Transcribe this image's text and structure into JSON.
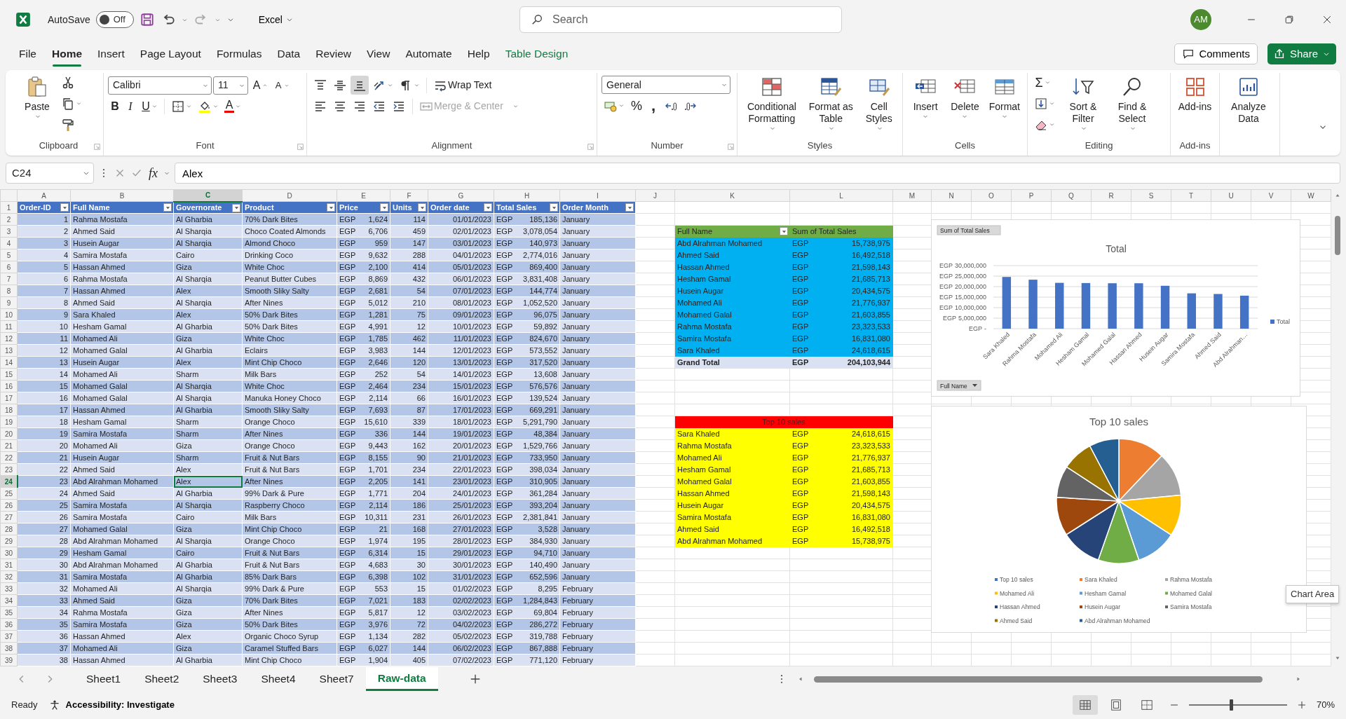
{
  "window": {
    "autosave": {
      "label": "AutoSave",
      "on": false,
      "state_text": "Off"
    },
    "app_menu": "Excel",
    "search": {
      "placeholder": "Search"
    },
    "avatar": "AM"
  },
  "menu_tabs": [
    {
      "label": "File",
      "selected": false,
      "kind": "plain"
    },
    {
      "label": "Home",
      "selected": true,
      "kind": "plain"
    },
    {
      "label": "Insert",
      "selected": false,
      "kind": "plain"
    },
    {
      "label": "Page Layout",
      "selected": false,
      "kind": "plain"
    },
    {
      "label": "Formulas",
      "selected": false,
      "kind": "plain"
    },
    {
      "label": "Data",
      "selected": false,
      "kind": "plain"
    },
    {
      "label": "Review",
      "selected": false,
      "kind": "plain"
    },
    {
      "label": "View",
      "selected": false,
      "kind": "plain"
    },
    {
      "label": "Automate",
      "selected": false,
      "kind": "plain"
    },
    {
      "label": "Help",
      "selected": false,
      "kind": "plain"
    },
    {
      "label": "Table Design",
      "selected": false,
      "kind": "contextual"
    }
  ],
  "comments": "Comments",
  "share": "Share",
  "ribbon": {
    "groups": [
      {
        "kind": "clipboard",
        "label": "Clipboard",
        "launcher": true,
        "paste": "Paste"
      },
      {
        "kind": "font",
        "label": "Font",
        "launcher": true,
        "font_name": "Calibri",
        "font_size": "11",
        "grow": "A",
        "shrink": "A",
        "bold": "B",
        "italic": "I",
        "underline": "U",
        "font_color": "A"
      },
      {
        "kind": "alignment",
        "label": "Alignment",
        "launcher": true,
        "vertical": [
          {
            "selected": false
          },
          {
            "selected": false
          },
          {
            "selected": true
          }
        ],
        "wrap_text": "Wrap Text",
        "merge": {
          "label": "Merge & Center",
          "disabled": true
        }
      },
      {
        "kind": "number",
        "label": "Number",
        "launcher": true,
        "format": "General",
        "percent": "%",
        "comma": ","
      },
      {
        "kind": "styles",
        "label": "Styles",
        "buttons": [
          "Conditional Formatting",
          "Format as Table",
          "Cell Styles"
        ]
      },
      {
        "kind": "cells",
        "label": "Cells",
        "buttons": [
          "Insert",
          "Delete",
          "Format"
        ]
      },
      {
        "kind": "editing",
        "label": "Editing",
        "sum": "Σ",
        "buttons": [
          "Sort & Filter",
          "Find & Select"
        ]
      },
      {
        "kind": "addins",
        "label": "Add-ins",
        "buttons": [
          "Add-ins"
        ]
      },
      {
        "kind": "analyze",
        "buttons": [
          "Analyze Data"
        ]
      }
    ]
  },
  "formula_bar": {
    "name_box": "C24",
    "fx": "fx",
    "value": "Alex"
  },
  "sheet": {
    "columns": [
      {
        "label": "A",
        "selected": false
      },
      {
        "label": "B",
        "selected": false
      },
      {
        "label": "C",
        "selected": true
      },
      {
        "label": "D",
        "selected": false
      },
      {
        "label": "E",
        "selected": false
      },
      {
        "label": "F",
        "selected": false
      },
      {
        "label": "G",
        "selected": false
      },
      {
        "label": "H",
        "selected": false
      },
      {
        "label": "I",
        "selected": false
      },
      {
        "label": "J",
        "selected": false
      },
      {
        "label": "K",
        "selected": false
      },
      {
        "label": "L",
        "selected": false
      },
      {
        "label": "M",
        "selected": false
      },
      {
        "label": "N",
        "selected": false
      },
      {
        "label": "O",
        "selected": false
      },
      {
        "label": "P",
        "selected": false
      },
      {
        "label": "Q",
        "selected": false
      },
      {
        "label": "R",
        "selected": false
      },
      {
        "label": "S",
        "selected": false
      },
      {
        "label": "T",
        "selected": false
      },
      {
        "label": "U",
        "selected": false
      },
      {
        "label": "V",
        "selected": false
      },
      {
        "label": "W",
        "selected": false
      }
    ],
    "table": {
      "header_row_number": "1",
      "headers": [
        "Order-ID",
        "Full Name",
        "Governorate",
        "Product",
        "Price",
        "Units",
        "Order date",
        "Total Sales",
        "Order Month"
      ],
      "rows": [
        {
          "n": "2",
          "selected": false,
          "cells": [
            "1",
            "Rahma Mostafa",
            "Al Gharbia",
            "70% Dark Bites",
            "EGP",
            "1,624",
            "114",
            "01/01/2023",
            "EGP",
            "185,136",
            "January"
          ]
        },
        {
          "n": "3",
          "selected": false,
          "cells": [
            "2",
            "Ahmed Said",
            "Al Sharqia",
            "Choco Coated Almonds",
            "EGP",
            "6,706",
            "459",
            "02/01/2023",
            "EGP",
            "3,078,054",
            "January"
          ]
        },
        {
          "n": "4",
          "selected": false,
          "cells": [
            "3",
            "Husein Augar",
            "Al Sharqia",
            "Almond Choco",
            "EGP",
            "959",
            "147",
            "03/01/2023",
            "EGP",
            "140,973",
            "January"
          ]
        },
        {
          "n": "5",
          "selected": false,
          "cells": [
            "4",
            "Samira Mostafa",
            "Cairo",
            "Drinking Coco",
            "EGP",
            "9,632",
            "288",
            "04/01/2023",
            "EGP",
            "2,774,016",
            "January"
          ]
        },
        {
          "n": "6",
          "selected": false,
          "cells": [
            "5",
            "Hassan Ahmed",
            "Giza",
            "White Choc",
            "EGP",
            "2,100",
            "414",
            "05/01/2023",
            "EGP",
            "869,400",
            "January"
          ]
        },
        {
          "n": "7",
          "selected": false,
          "cells": [
            "6",
            "Rahma Mostafa",
            "Al Sharqia",
            "Peanut Butter Cubes",
            "EGP",
            "8,869",
            "432",
            "06/01/2023",
            "EGP",
            "3,831,408",
            "January"
          ]
        },
        {
          "n": "8",
          "selected": false,
          "cells": [
            "7",
            "Hassan Ahmed",
            "Alex",
            "Smooth Sliky Salty",
            "EGP",
            "2,681",
            "54",
            "07/01/2023",
            "EGP",
            "144,774",
            "January"
          ]
        },
        {
          "n": "9",
          "selected": false,
          "cells": [
            "8",
            "Ahmed Said",
            "Al Sharqia",
            "After Nines",
            "EGP",
            "5,012",
            "210",
            "08/01/2023",
            "EGP",
            "1,052,520",
            "January"
          ]
        },
        {
          "n": "10",
          "selected": false,
          "cells": [
            "9",
            "Sara Khaled",
            "Alex",
            "50% Dark Bites",
            "EGP",
            "1,281",
            "75",
            "09/01/2023",
            "EGP",
            "96,075",
            "January"
          ]
        },
        {
          "n": "11",
          "selected": false,
          "cells": [
            "10",
            "Hesham Gamal",
            "Al Gharbia",
            "50% Dark Bites",
            "EGP",
            "4,991",
            "12",
            "10/01/2023",
            "EGP",
            "59,892",
            "January"
          ]
        },
        {
          "n": "12",
          "selected": false,
          "cells": [
            "11",
            "Mohamed Ali",
            "Giza",
            "White Choc",
            "EGP",
            "1,785",
            "462",
            "11/01/2023",
            "EGP",
            "824,670",
            "January"
          ]
        },
        {
          "n": "13",
          "selected": false,
          "cells": [
            "12",
            "Mohamed Galal",
            "Al Gharbia",
            "Eclairs",
            "EGP",
            "3,983",
            "144",
            "12/01/2023",
            "EGP",
            "573,552",
            "January"
          ]
        },
        {
          "n": "14",
          "selected": false,
          "cells": [
            "13",
            "Husein Augar",
            "Alex",
            "Mint Chip Choco",
            "EGP",
            "2,646",
            "120",
            "13/01/2023",
            "EGP",
            "317,520",
            "January"
          ]
        },
        {
          "n": "15",
          "selected": false,
          "cells": [
            "14",
            "Mohamed Ali",
            "Sharm",
            "Milk Bars",
            "EGP",
            "252",
            "54",
            "14/01/2023",
            "EGP",
            "13,608",
            "January"
          ]
        },
        {
          "n": "16",
          "selected": false,
          "cells": [
            "15",
            "Mohamed Galal",
            "Al Sharqia",
            "White Choc",
            "EGP",
            "2,464",
            "234",
            "15/01/2023",
            "EGP",
            "576,576",
            "January"
          ]
        },
        {
          "n": "17",
          "selected": false,
          "cells": [
            "16",
            "Mohamed Galal",
            "Al Sharqia",
            "Manuka Honey Choco",
            "EGP",
            "2,114",
            "66",
            "16/01/2023",
            "EGP",
            "139,524",
            "January"
          ]
        },
        {
          "n": "18",
          "selected": false,
          "cells": [
            "17",
            "Hassan Ahmed",
            "Al Gharbia",
            "Smooth Sliky Salty",
            "EGP",
            "7,693",
            "87",
            "17/01/2023",
            "EGP",
            "669,291",
            "January"
          ]
        },
        {
          "n": "19",
          "selected": false,
          "cells": [
            "18",
            "Hesham Gamal",
            "Sharm",
            "Orange Choco",
            "EGP",
            "15,610",
            "339",
            "18/01/2023",
            "EGP",
            "5,291,790",
            "January"
          ]
        },
        {
          "n": "20",
          "selected": false,
          "cells": [
            "19",
            "Samira Mostafa",
            "Sharm",
            "After Nines",
            "EGP",
            "336",
            "144",
            "19/01/2023",
            "EGP",
            "48,384",
            "January"
          ]
        },
        {
          "n": "21",
          "selected": false,
          "cells": [
            "20",
            "Mohamed Ali",
            "Giza",
            "Orange Choco",
            "EGP",
            "9,443",
            "162",
            "20/01/2023",
            "EGP",
            "1,529,766",
            "January"
          ]
        },
        {
          "n": "22",
          "selected": false,
          "cells": [
            "21",
            "Husein Augar",
            "Sharm",
            "Fruit & Nut Bars",
            "EGP",
            "8,155",
            "90",
            "21/01/2023",
            "EGP",
            "733,950",
            "January"
          ]
        },
        {
          "n": "23",
          "selected": false,
          "cells": [
            "22",
            "Ahmed Said",
            "Alex",
            "Fruit & Nut Bars",
            "EGP",
            "1,701",
            "234",
            "22/01/2023",
            "EGP",
            "398,034",
            "January"
          ]
        },
        {
          "n": "24",
          "selected": true,
          "cells": [
            "23",
            "Abd Alrahman Mohamed",
            "Alex",
            "After Nines",
            "EGP",
            "2,205",
            "141",
            "23/01/2023",
            "EGP",
            "310,905",
            "January"
          ]
        },
        {
          "n": "25",
          "selected": false,
          "cells": [
            "24",
            "Ahmed Said",
            "Al Gharbia",
            "99% Dark & Pure",
            "EGP",
            "1,771",
            "204",
            "24/01/2023",
            "EGP",
            "361,284",
            "January"
          ]
        },
        {
          "n": "26",
          "selected": false,
          "cells": [
            "25",
            "Samira Mostafa",
            "Al Sharqia",
            "Raspberry Choco",
            "EGP",
            "2,114",
            "186",
            "25/01/2023",
            "EGP",
            "393,204",
            "January"
          ]
        },
        {
          "n": "27",
          "selected": false,
          "cells": [
            "26",
            "Samira Mostafa",
            "Cairo",
            "Milk Bars",
            "EGP",
            "10,311",
            "231",
            "26/01/2023",
            "EGP",
            "2,381,841",
            "January"
          ]
        },
        {
          "n": "28",
          "selected": false,
          "cells": [
            "27",
            "Mohamed Galal",
            "Giza",
            "Mint Chip Choco",
            "EGP",
            "21",
            "168",
            "27/01/2023",
            "EGP",
            "3,528",
            "January"
          ]
        },
        {
          "n": "29",
          "selected": false,
          "cells": [
            "28",
            "Abd Alrahman Mohamed",
            "Al Sharqia",
            "Orange Choco",
            "EGP",
            "1,974",
            "195",
            "28/01/2023",
            "EGP",
            "384,930",
            "January"
          ]
        },
        {
          "n": "30",
          "selected": false,
          "cells": [
            "29",
            "Hesham Gamal",
            "Cairo",
            "Fruit & Nut Bars",
            "EGP",
            "6,314",
            "15",
            "29/01/2023",
            "EGP",
            "94,710",
            "January"
          ]
        },
        {
          "n": "31",
          "selected": false,
          "cells": [
            "30",
            "Abd Alrahman Mohamed",
            "Al Gharbia",
            "Fruit & Nut Bars",
            "EGP",
            "4,683",
            "30",
            "30/01/2023",
            "EGP",
            "140,490",
            "January"
          ]
        },
        {
          "n": "32",
          "selected": false,
          "cells": [
            "31",
            "Samira Mostafa",
            "Al Gharbia",
            "85% Dark Bars",
            "EGP",
            "6,398",
            "102",
            "31/01/2023",
            "EGP",
            "652,596",
            "January"
          ]
        },
        {
          "n": "33",
          "selected": false,
          "cells": [
            "32",
            "Mohamed Ali",
            "Al Sharqia",
            "99% Dark & Pure",
            "EGP",
            "553",
            "15",
            "01/02/2023",
            "EGP",
            "8,295",
            "February"
          ]
        },
        {
          "n": "34",
          "selected": false,
          "cells": [
            "33",
            "Ahmed Said",
            "Giza",
            "70% Dark Bites",
            "EGP",
            "7,021",
            "183",
            "02/02/2023",
            "EGP",
            "1,284,843",
            "February"
          ]
        },
        {
          "n": "35",
          "selected": false,
          "cells": [
            "34",
            "Rahma Mostafa",
            "Giza",
            "After Nines",
            "EGP",
            "5,817",
            "12",
            "03/02/2023",
            "EGP",
            "69,804",
            "February"
          ]
        },
        {
          "n": "36",
          "selected": false,
          "cells": [
            "35",
            "Samira Mostafa",
            "Giza",
            "50% Dark Bites",
            "EGP",
            "3,976",
            "72",
            "04/02/2023",
            "EGP",
            "286,272",
            "February"
          ]
        },
        {
          "n": "37",
          "selected": false,
          "cells": [
            "36",
            "Hassan Ahmed",
            "Alex",
            "Organic Choco Syrup",
            "EGP",
            "1,134",
            "282",
            "05/02/2023",
            "EGP",
            "319,788",
            "February"
          ]
        },
        {
          "n": "38",
          "selected": false,
          "cells": [
            "37",
            "Mohamed Ali",
            "Giza",
            "Caramel Stuffed Bars",
            "EGP",
            "6,027",
            "144",
            "06/02/2023",
            "EGP",
            "867,888",
            "February"
          ]
        },
        {
          "n": "39",
          "selected": false,
          "cells": [
            "38",
            "Hassan Ahmed",
            "Al Gharbia",
            "Mint Chip Choco",
            "EGP",
            "1,904",
            "405",
            "07/02/2023",
            "EGP",
            "771,120",
            "February"
          ]
        }
      ]
    },
    "pivot": {
      "headers": [
        "Full Name",
        "Sum of Total Sales"
      ],
      "rows": [
        {
          "name": "Abd Alrahman Mohamed",
          "currency": "EGP",
          "amount": "15,738,975"
        },
        {
          "name": "Ahmed Said",
          "currency": "EGP",
          "amount": "16,492,518"
        },
        {
          "name": "Hassan Ahmed",
          "currency": "EGP",
          "amount": "21,598,143"
        },
        {
          "name": "Hesham Gamal",
          "currency": "EGP",
          "amount": "21,685,713"
        },
        {
          "name": "Husein Augar",
          "currency": "EGP",
          "amount": "20,434,575"
        },
        {
          "name": "Mohamed Ali",
          "currency": "EGP",
          "amount": "21,776,937"
        },
        {
          "name": "Mohamed Galal",
          "currency": "EGP",
          "amount": "21,603,855"
        },
        {
          "name": "Rahma Mostafa",
          "currency": "EGP",
          "amount": "23,323,533"
        },
        {
          "name": "Samira Mostafa",
          "currency": "EGP",
          "amount": "16,831,080"
        },
        {
          "name": "Sara Khaled",
          "currency": "EGP",
          "amount": "24,618,615"
        }
      ],
      "total": {
        "name": "Grand Total",
        "currency": "EGP",
        "amount": "204,103,944"
      }
    },
    "top10": {
      "title": "Top 10 sales",
      "rows": [
        {
          "name": "Sara Khaled",
          "currency": "EGP",
          "amount": "24,618,615"
        },
        {
          "name": "Rahma Mostafa",
          "currency": "EGP",
          "amount": "23,323,533"
        },
        {
          "name": "Mohamed Ali",
          "currency": "EGP",
          "amount": "21,776,937"
        },
        {
          "name": "Hesham Gamal",
          "currency": "EGP",
          "amount": "21,685,713"
        },
        {
          "name": "Mohamed Galal",
          "currency": "EGP",
          "amount": "21,603,855"
        },
        {
          "name": "Hassan Ahmed",
          "currency": "EGP",
          "amount": "21,598,143"
        },
        {
          "name": "Husein Augar",
          "currency": "EGP",
          "amount": "20,434,575"
        },
        {
          "name": "Samira Mostafa",
          "currency": "EGP",
          "amount": "16,831,080"
        },
        {
          "name": "Ahmed Said",
          "currency": "EGP",
          "amount": "16,492,518"
        },
        {
          "name": "Abd Alrahman Mohamed",
          "currency": "EGP",
          "amount": "15,738,975"
        }
      ]
    }
  },
  "bar_chart": {
    "field_button": "Sum of Total Sales",
    "axis_button": "Full Name",
    "chart_data": {
      "type": "bar",
      "title": "Total",
      "categories": [
        "Sara Khaled",
        "Rahma Mostafa",
        "Mohamed Ali",
        "Hesham Gamal",
        "Mohamed Galal",
        "Hassan Ahmed",
        "Husein Augar",
        "Samira Mostafa",
        "Ahmed Said",
        "Abd Alrahman…"
      ],
      "series": [
        {
          "name": "Total",
          "color": "#4472c4",
          "values": [
            24600000,
            23300000,
            21800000,
            21700000,
            21600000,
            21600000,
            20400000,
            16800000,
            16500000,
            15700000
          ]
        }
      ],
      "ylim": [
        0,
        30000000
      ],
      "grid": true,
      "yticks": [
        {
          "value": 0,
          "label": "-"
        },
        {
          "value": 5000000,
          "label": "5,000,000"
        },
        {
          "value": 10000000,
          "label": "10,000,000"
        },
        {
          "value": 15000000,
          "label": "15,000,000"
        },
        {
          "value": 20000000,
          "label": "20,000,000"
        },
        {
          "value": 25000000,
          "label": "25,000,000"
        },
        {
          "value": 30000000,
          "label": "30,000,000"
        }
      ],
      "annotations": [
        "EGP",
        "EGP",
        "EGP",
        "EGP",
        "EGP",
        "EGP",
        "EGP"
      ]
    }
  },
  "pie_chart": {
    "title": "Top 10 sales",
    "legend": [
      {
        "label": "Top 10 sales",
        "color": "#4472c4"
      },
      {
        "label": "Sara Khaled",
        "color": "#ed7d31"
      },
      {
        "label": "Rahma Mostafa",
        "color": "#a5a5a5"
      },
      {
        "label": "Mohamed Ali",
        "color": "#ffc000"
      },
      {
        "label": "Hesham Gamal",
        "color": "#5b9bd5"
      },
      {
        "label": "Mohamed Galal",
        "color": "#70ad47"
      },
      {
        "label": "Hassan Ahmed",
        "color": "#264478"
      },
      {
        "label": "Husein Augar",
        "color": "#9e480e"
      },
      {
        "label": "Samira Mostafa",
        "color": "#636363"
      },
      {
        "label": "Ahmed Said",
        "color": "#997300"
      },
      {
        "label": "Abd Alrahman Mohamed",
        "color": "#255e91"
      }
    ]
  },
  "tooltip": "Chart Area",
  "sheet_tabs": [
    {
      "label": "Sheet1",
      "selected": false
    },
    {
      "label": "Sheet2",
      "selected": false
    },
    {
      "label": "Sheet3",
      "selected": false
    },
    {
      "label": "Sheet4",
      "selected": false
    },
    {
      "label": "Sheet7",
      "selected": false
    },
    {
      "label": "Raw-data",
      "selected": true
    }
  ],
  "status_bar": {
    "ready": "Ready",
    "accessibility": "Accessibility: Investigate",
    "views": [
      {
        "kind": "normal",
        "selected": true
      },
      {
        "kind": "page_layout",
        "selected": false
      },
      {
        "kind": "page_break",
        "selected": false
      }
    ],
    "zoom": {
      "label": "70%",
      "level": 0.43
    }
  }
}
